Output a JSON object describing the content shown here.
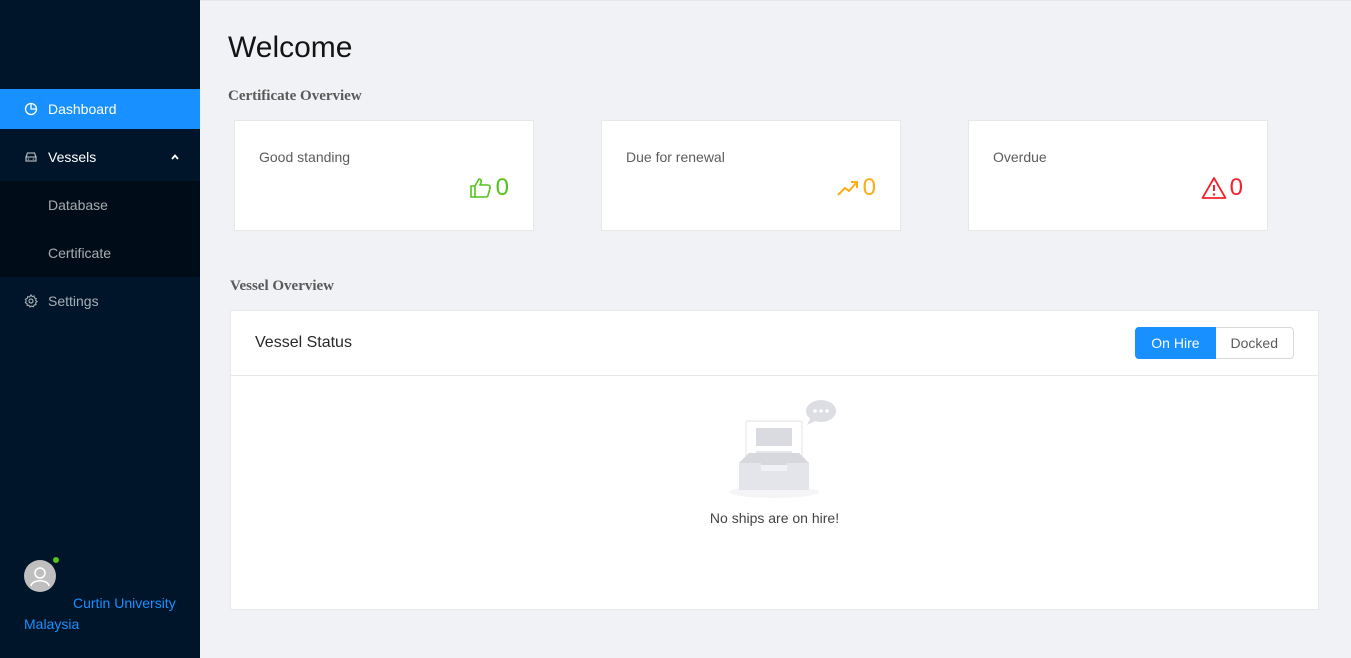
{
  "sidebar": {
    "items": [
      {
        "label": "Dashboard",
        "icon": "pie-chart-icon"
      },
      {
        "label": "Vessels",
        "icon": "car-icon"
      },
      {
        "label": "Settings",
        "icon": "gear-icon"
      }
    ],
    "vessels_sub": [
      "Database",
      "Certificate"
    ],
    "user": {
      "name": "Curtin University Malaysia",
      "status_color": "#52c41a"
    }
  },
  "main": {
    "title": "Welcome",
    "certificate_section": "Certificate Overview",
    "cards": [
      {
        "label": "Good standing",
        "value": "0",
        "icon": "thumbs-up-icon",
        "color": "#52c41a"
      },
      {
        "label": "Due for renewal",
        "value": "0",
        "icon": "trend-up-icon",
        "color": "#faad14"
      },
      {
        "label": "Overdue",
        "value": "0",
        "icon": "warning-icon",
        "color": "#f5222d"
      }
    ],
    "vessel_section": "Vessel Overview",
    "panel": {
      "title": "Vessel Status",
      "toggle": [
        "On Hire",
        "Docked"
      ],
      "selected": "On Hire",
      "empty_text": "No ships are on hire!"
    }
  },
  "colors": {
    "accent": "#1890ff",
    "sidebar_bg": "#001529"
  }
}
